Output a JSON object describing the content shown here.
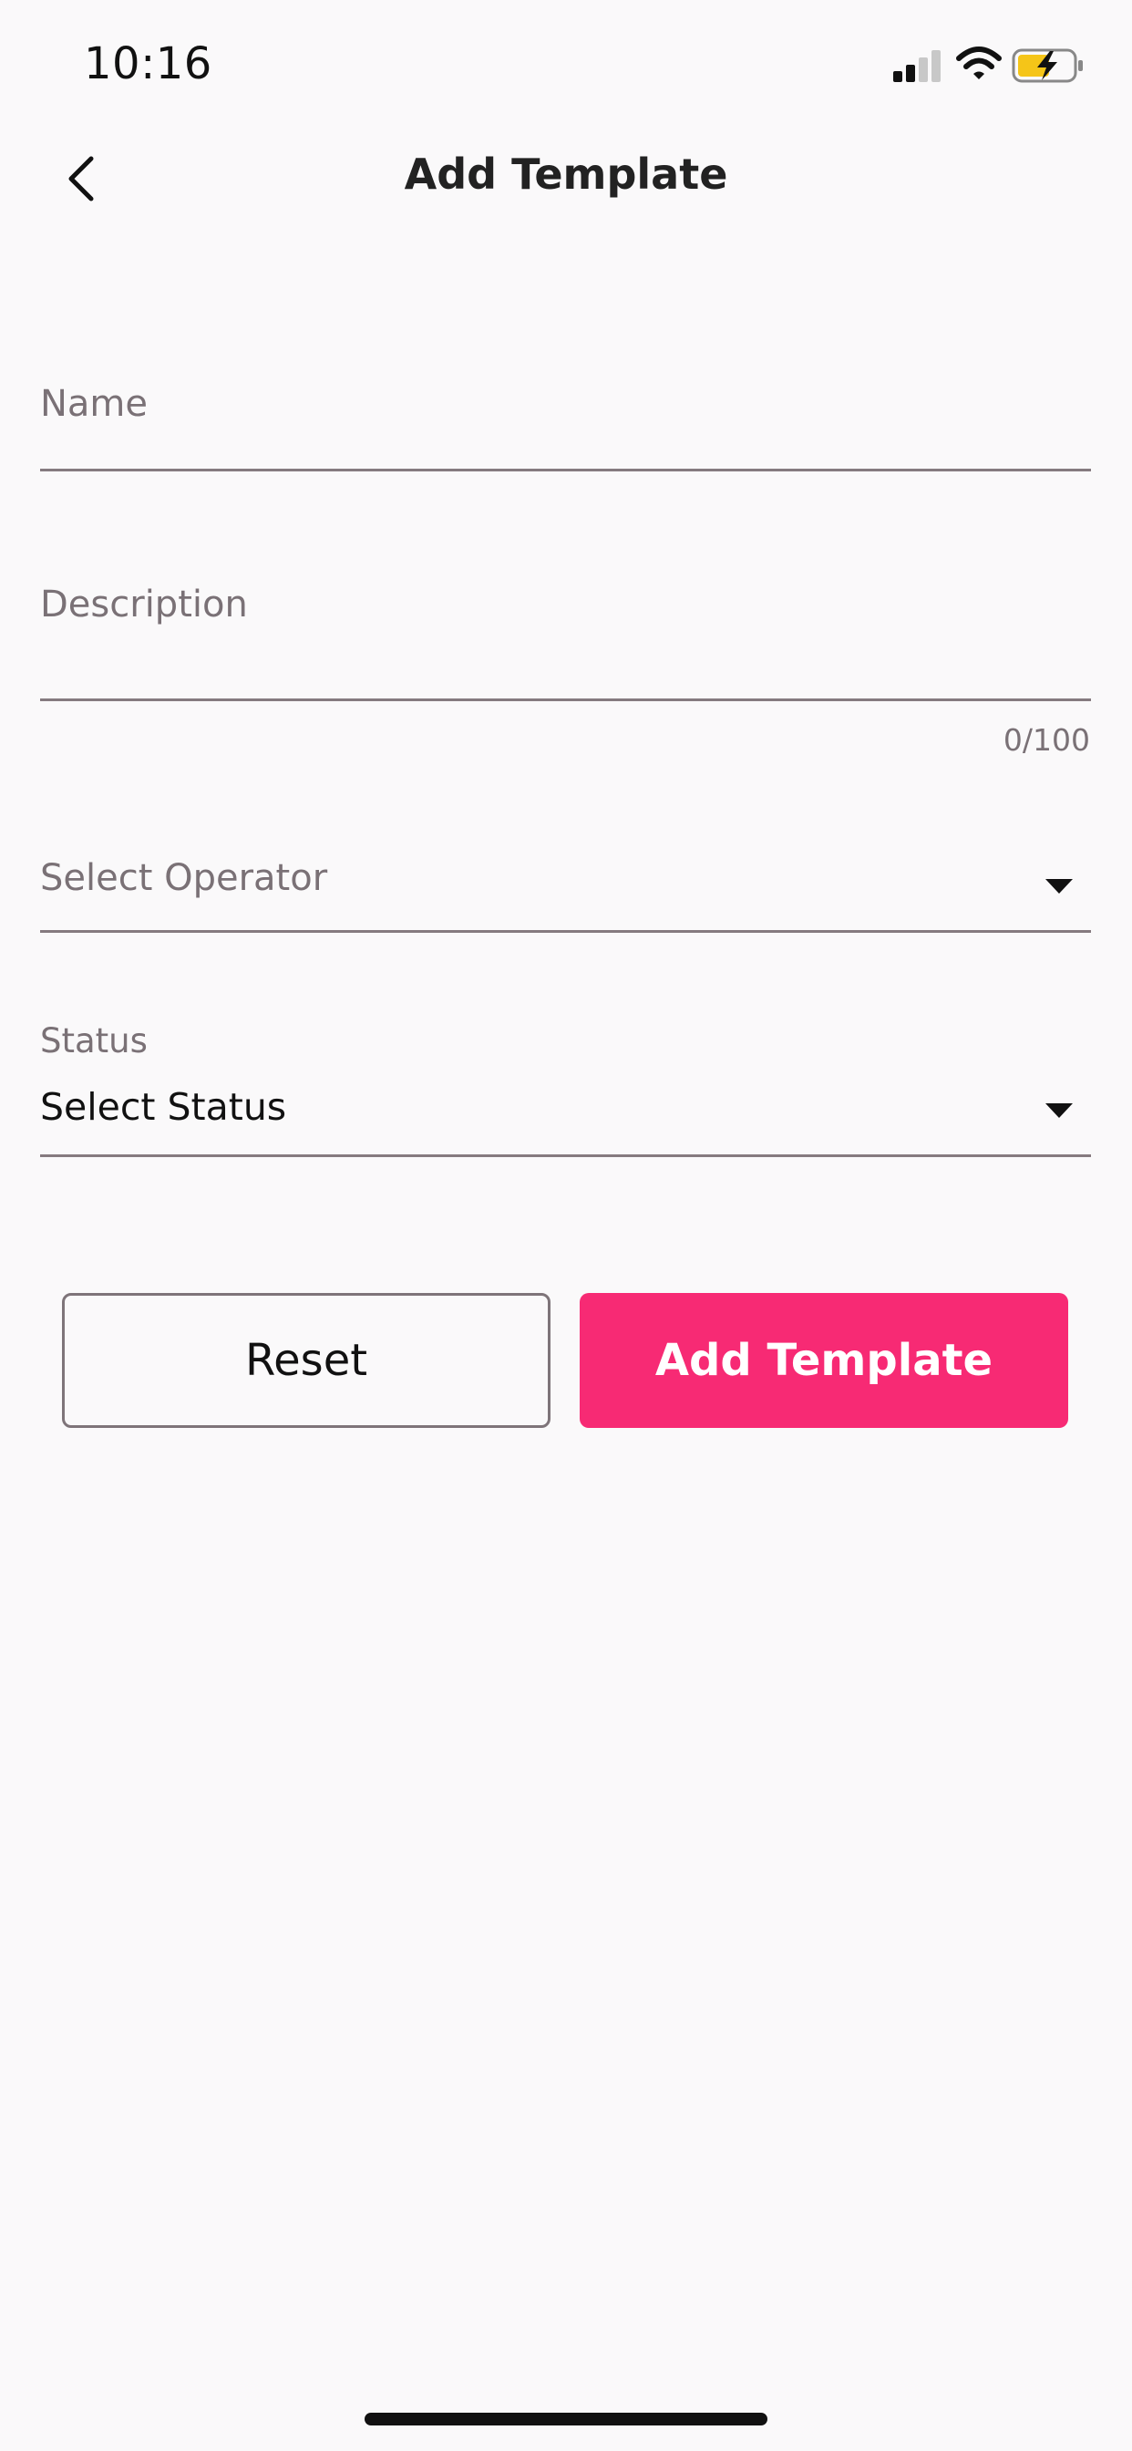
{
  "status_bar": {
    "time": "10:16",
    "signal_icon": "cellular-signal-icon",
    "wifi_icon": "wifi-icon",
    "battery_icon": "battery-charging-icon",
    "battery_color": "#f5c518"
  },
  "header": {
    "title": "Add Template",
    "back_icon": "chevron-left-icon"
  },
  "form": {
    "name": {
      "placeholder": "Name",
      "value": ""
    },
    "description": {
      "placeholder": "Description",
      "value": "",
      "counter": "0/100"
    },
    "operator": {
      "placeholder": "Select Operator",
      "icon": "caret-down-icon"
    },
    "status": {
      "label": "Status",
      "value": "Select Status",
      "icon": "caret-down-icon"
    }
  },
  "actions": {
    "reset_label": "Reset",
    "submit_label": "Add Template",
    "accent_color": "#f72a74"
  }
}
